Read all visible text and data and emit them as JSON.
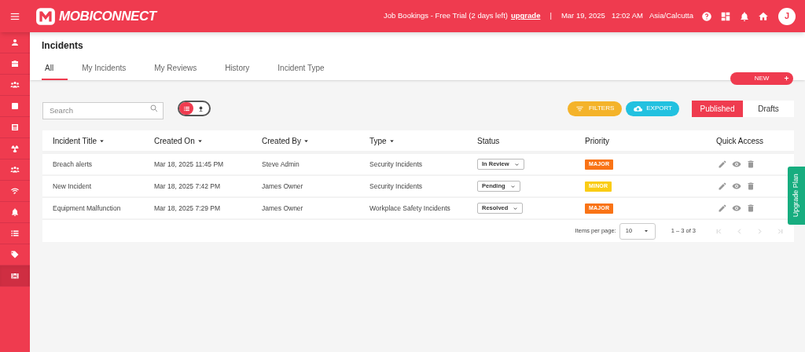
{
  "header": {
    "logo_text": "MOBICONNECT",
    "trial_text": "Job Bookings - Free Trial (2 days left)",
    "upgrade_link": "upgrade",
    "separator": "|",
    "date": "Mar 19, 2025",
    "time": "12:02 AM",
    "timezone": "Asia/Calcutta",
    "avatar": "J"
  },
  "sidebar": {
    "items": [
      {
        "selected": false
      },
      {
        "selected": false
      },
      {
        "selected": false
      },
      {
        "selected": false
      },
      {
        "selected": false
      },
      {
        "selected": false
      },
      {
        "selected": false
      },
      {
        "selected": false
      },
      {
        "selected": false
      },
      {
        "selected": false
      },
      {
        "selected": false
      },
      {
        "selected": true
      }
    ]
  },
  "page_title": "Incidents",
  "tabs": [
    {
      "label": "All",
      "selected": true
    },
    {
      "label": "My Incidents",
      "selected": false
    },
    {
      "label": "My Reviews",
      "selected": false
    },
    {
      "label": "History",
      "selected": false
    },
    {
      "label": "Incident Type",
      "selected": false
    }
  ],
  "new_button": "NEW",
  "search": {
    "placeholder": "Search"
  },
  "view_toggle": [
    {
      "selected": true
    },
    {
      "selected": false
    }
  ],
  "filters_button": "FILTERS",
  "export_button": "EXPORT",
  "publish_tabs": [
    {
      "label": "Published",
      "selected": true
    },
    {
      "label": "Drafts",
      "selected": false
    }
  ],
  "table": {
    "columns": [
      {
        "label": "Incident Title",
        "sortable": true
      },
      {
        "label": "Created On",
        "sortable": true
      },
      {
        "label": "Created By",
        "sortable": true
      },
      {
        "label": "Type",
        "sortable": true
      },
      {
        "label": "Status",
        "sortable": false
      },
      {
        "label": "Priority",
        "sortable": false
      },
      {
        "label": "Quick Access",
        "sortable": false
      }
    ],
    "rows": [
      {
        "title": "Breach alerts",
        "created_on": "Mar 18, 2025 11:45 PM",
        "created_by": "Steve Admin",
        "type": "Security Incidents",
        "status": "In Review",
        "priority": "MAJOR",
        "color": "#f97316"
      },
      {
        "title": "New Incident",
        "created_on": "Mar 18, 2025 7:42 PM",
        "created_by": "James Owner",
        "type": "Security Incidents",
        "status": "Pending",
        "priority": "MINOR",
        "color": "#facc15"
      },
      {
        "title": "Equipment Malfunction",
        "created_on": "Mar 18, 2025 7:29 PM",
        "created_by": "James Owner",
        "type": "Workplace Safety Incidents",
        "status": "Resolved",
        "priority": "MAJOR",
        "color": "#f97316"
      }
    ]
  },
  "pagination": {
    "label": "Items per page:",
    "page_size": "10",
    "range": "1 – 3 of 3"
  },
  "upgrade_tab": "Upgrade Plan"
}
